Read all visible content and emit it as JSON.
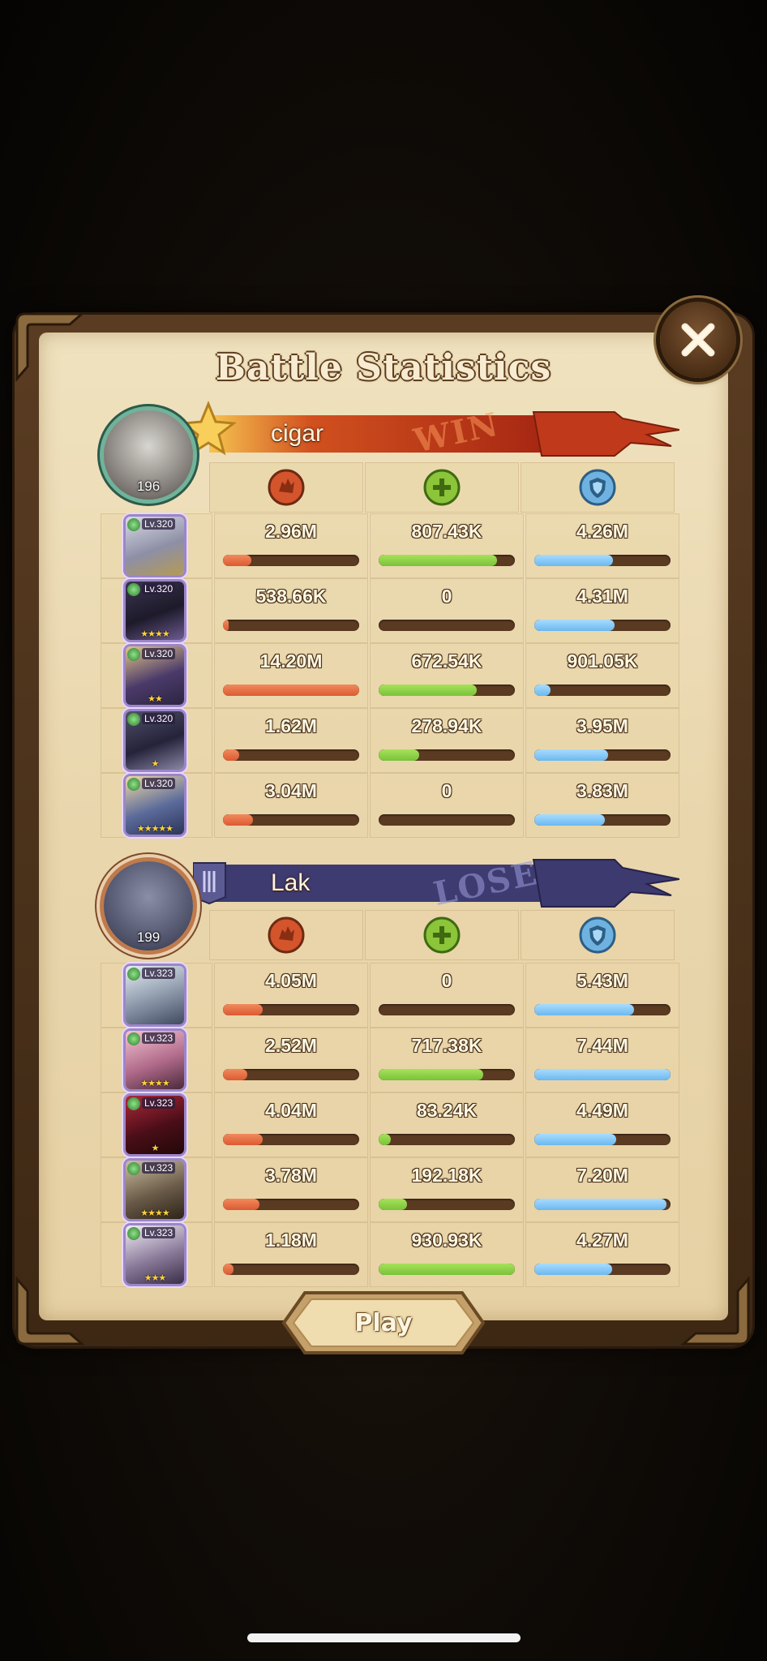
{
  "title": "Battle Statistics",
  "close_label": "✕",
  "play_label": "Play",
  "stat_icons": [
    "damage-fist-icon",
    "heal-cross-icon",
    "shield-icon"
  ],
  "colors": {
    "damage": "#dd5a32",
    "heal": "#79c23a",
    "tank": "#6cb8ef",
    "win_banner": "#c0391a",
    "lose_banner": "#3c3a6e"
  },
  "teams": [
    {
      "name": "cigar",
      "result": "WIN",
      "level": "196",
      "heroes": [
        {
          "level": "Lv.320",
          "stars": "",
          "damage": "2.96M",
          "heal": "807.43K",
          "tank": "4.26M",
          "damage_pct": 0.21,
          "heal_pct": 0.87,
          "tank_pct": 0.58
        },
        {
          "level": "Lv.320",
          "stars": "★★★★",
          "damage": "538.66K",
          "heal": "0",
          "tank": "4.31M",
          "damage_pct": 0.04,
          "heal_pct": 0,
          "tank_pct": 0.59
        },
        {
          "level": "Lv.320",
          "stars": "★★",
          "damage": "14.20M",
          "heal": "672.54K",
          "tank": "901.05K",
          "damage_pct": 1.0,
          "heal_pct": 0.72,
          "tank_pct": 0.12
        },
        {
          "level": "Lv.320",
          "stars": "★",
          "damage": "1.62M",
          "heal": "278.94K",
          "tank": "3.95M",
          "damage_pct": 0.12,
          "heal_pct": 0.3,
          "tank_pct": 0.54
        },
        {
          "level": "Lv.320",
          "stars": "★★★★★",
          "damage": "3.04M",
          "heal": "0",
          "tank": "3.83M",
          "damage_pct": 0.22,
          "heal_pct": 0,
          "tank_pct": 0.52
        }
      ]
    },
    {
      "name": "Lak",
      "result": "LOSE",
      "level": "199",
      "heroes": [
        {
          "level": "Lv.323",
          "stars": "",
          "damage": "4.05M",
          "heal": "0",
          "tank": "5.43M",
          "damage_pct": 0.29,
          "heal_pct": 0,
          "tank_pct": 0.73
        },
        {
          "level": "Lv.323",
          "stars": "★★★★",
          "damage": "2.52M",
          "heal": "717.38K",
          "tank": "7.44M",
          "damage_pct": 0.18,
          "heal_pct": 0.77,
          "tank_pct": 1.0
        },
        {
          "level": "Lv.323",
          "stars": "★",
          "damage": "4.04M",
          "heal": "83.24K",
          "tank": "4.49M",
          "damage_pct": 0.29,
          "heal_pct": 0.09,
          "tank_pct": 0.6
        },
        {
          "level": "Lv.323",
          "stars": "★★★★",
          "damage": "3.78M",
          "heal": "192.18K",
          "tank": "7.20M",
          "damage_pct": 0.27,
          "heal_pct": 0.21,
          "tank_pct": 0.97
        },
        {
          "level": "Lv.323",
          "stars": "★★★",
          "damage": "1.18M",
          "heal": "930.93K",
          "tank": "4.27M",
          "damage_pct": 0.08,
          "heal_pct": 1.0,
          "tank_pct": 0.57
        }
      ]
    }
  ]
}
